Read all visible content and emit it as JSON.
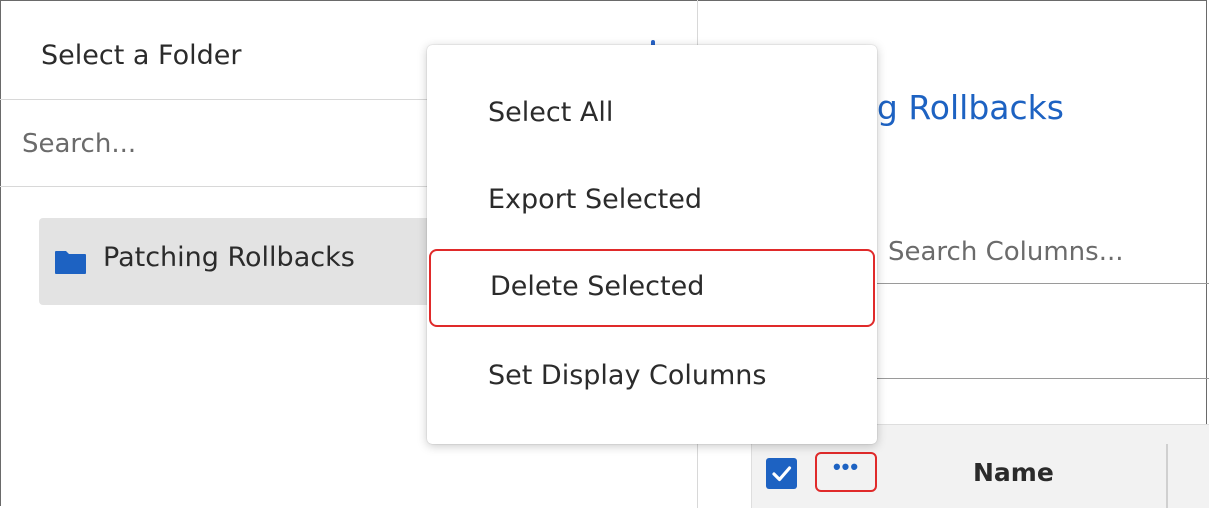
{
  "folder_panel": {
    "title": "Select a Folder",
    "search_placeholder": "Search...",
    "folders": [
      {
        "label": "Patching Rollbacks",
        "icon": "folder-icon",
        "selected": true
      }
    ]
  },
  "content_panel": {
    "title_visible": "ng Rollbacks",
    "columns_search_placeholder": "Search Columns...",
    "grid": {
      "select_all_checked": true,
      "more_button_label": "•••",
      "columns": [
        "Name"
      ]
    }
  },
  "context_menu": {
    "items": [
      {
        "label": "Select All",
        "highlighted": false
      },
      {
        "label": "Export Selected",
        "highlighted": false
      },
      {
        "label": "Delete Selected",
        "highlighted": true
      },
      {
        "label": "Set Display Columns",
        "highlighted": false
      }
    ]
  },
  "colors": {
    "accent": "#1d62c2",
    "highlight_border": "#e02a2a",
    "selected_item_bg": "#e3e3e3"
  }
}
